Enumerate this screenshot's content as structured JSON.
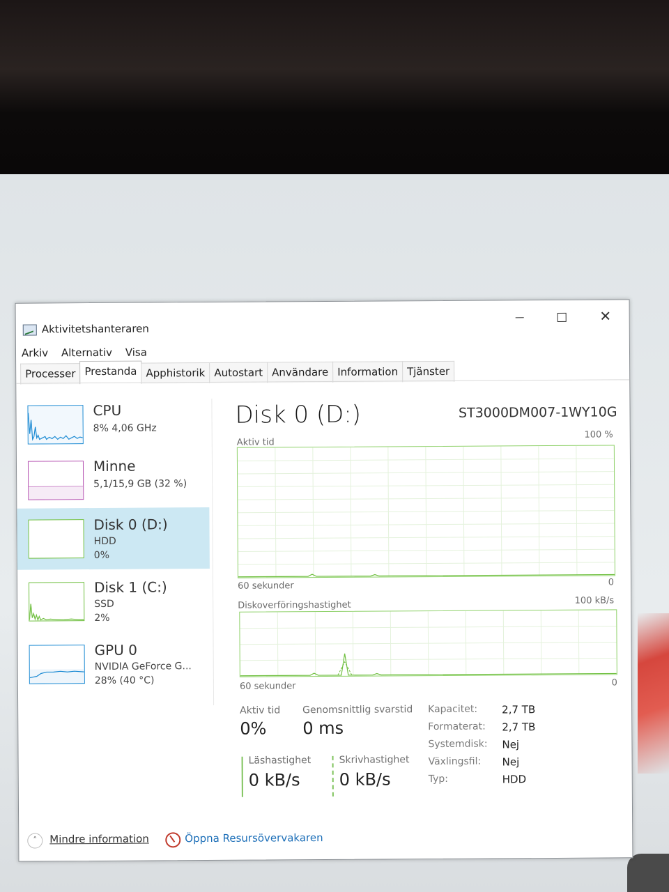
{
  "window": {
    "title": "Aktivitetshanteraren",
    "controls": [
      "minimize",
      "maximize",
      "close"
    ],
    "close_glyph": "✕"
  },
  "menu": [
    "Arkiv",
    "Alternativ",
    "Visa"
  ],
  "tabs": [
    "Processer",
    "Prestanda",
    "Apphistorik",
    "Autostart",
    "Användare",
    "Information",
    "Tjänster"
  ],
  "active_tab": "Prestanda",
  "sidebar": {
    "items": [
      {
        "title": "CPU",
        "sub1": "8% 4,06 GHz",
        "sub2": "",
        "sub3": "",
        "color": "#1b8ad3"
      },
      {
        "title": "Minne",
        "sub1": "5,1/15,9 GB (32 %)",
        "sub2": "",
        "sub3": "",
        "color": "#b44fb0"
      },
      {
        "title": "Disk 0 (D:)",
        "sub1": "HDD",
        "sub2": "0%",
        "sub3": "",
        "color": "#6fbf3f",
        "selected": true
      },
      {
        "title": "Disk 1 (C:)",
        "sub1": "SSD",
        "sub2": "2%",
        "sub3": "",
        "color": "#6fbf3f"
      },
      {
        "title": "GPU 0",
        "sub1": "NVIDIA GeForce G...",
        "sub2": "28% (40 °C)",
        "sub3": "",
        "color": "#1b8ad3"
      }
    ]
  },
  "detail": {
    "title": "Disk 0 (D:)",
    "model": "ST3000DM007-1WY10G",
    "graph1": {
      "label": "Aktiv tid",
      "max": "100 %",
      "time": "60 sekunder",
      "min": "0"
    },
    "graph2": {
      "label": "Diskoverföringshastighet",
      "max": "100 kB/s",
      "time": "60 sekunder",
      "min": "0"
    },
    "stats": {
      "active_label": "Aktiv tid",
      "active_value": "0%",
      "resp_label": "Genomsnittlig svarstid",
      "resp_value": "0 ms",
      "read_label": "Läshastighet",
      "read_value": "0 kB/s",
      "write_label": "Skrivhastighet",
      "write_value": "0 kB/s"
    },
    "properties": [
      {
        "key": "Kapacitet:",
        "value": "2,7 TB"
      },
      {
        "key": "Formaterat:",
        "value": "2,7 TB"
      },
      {
        "key": "Systemdisk:",
        "value": "Nej"
      },
      {
        "key": "Växlingsfil:",
        "value": "Nej"
      },
      {
        "key": "Typ:",
        "value": "HDD"
      }
    ]
  },
  "footer": {
    "less_info": "Mindre information",
    "open_monitor": "Öppna Resursövervakaren"
  }
}
